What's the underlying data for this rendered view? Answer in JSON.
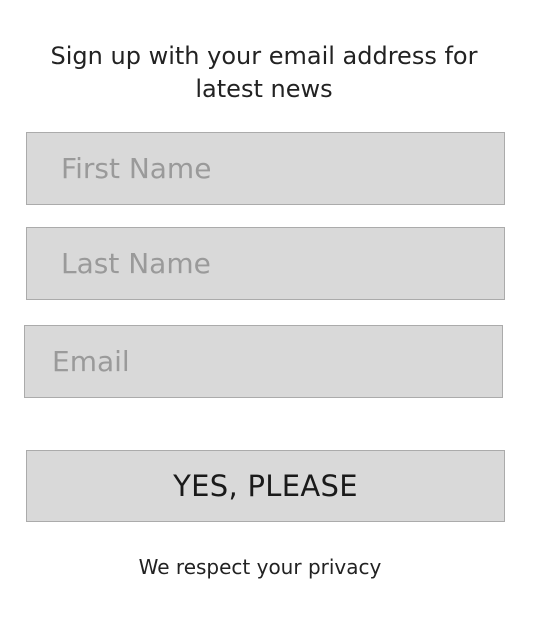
{
  "form": {
    "heading": "Sign up with your email address for latest news",
    "first_name": {
      "placeholder": "First Name",
      "value": ""
    },
    "last_name": {
      "placeholder": "Last Name",
      "value": ""
    },
    "email": {
      "placeholder": "Email",
      "value": ""
    },
    "submit_label": "YES, PLEASE",
    "privacy_note": "We respect your privacy"
  },
  "colors": {
    "field_background": "#d9d9d9",
    "field_border": "#ababab",
    "placeholder_text": "#9a9a9a",
    "text": "#222222"
  }
}
